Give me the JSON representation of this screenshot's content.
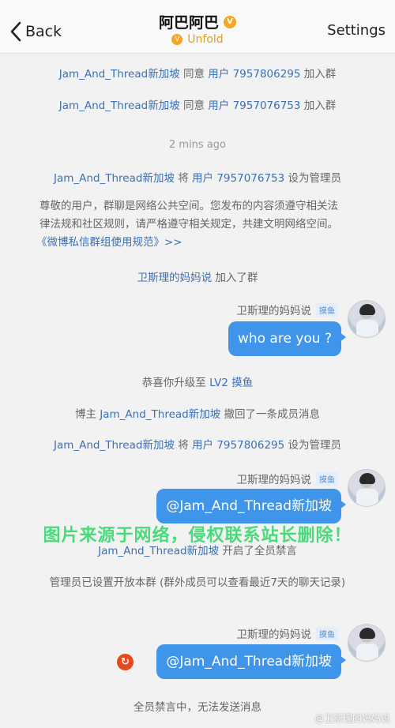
{
  "nav": {
    "back_label": "Back",
    "title": "阿巴阿巴",
    "unfold_label": "Unfold",
    "settings_label": "Settings"
  },
  "messages": {
    "m1": {
      "name": "Jam_And_Thread新加坡",
      "action": " 同意 ",
      "user": "用户 7957806295",
      "suffix": " 加入群"
    },
    "m2": {
      "name": "Jam_And_Thread新加坡",
      "action": " 同意 ",
      "user": "用户 7957076753",
      "suffix": " 加入群"
    },
    "time": "2 mins ago",
    "m3": {
      "name": "Jam_And_Thread新加坡",
      "action": " 将 ",
      "user": "用户 7957076753",
      "suffix": " 设为管理员"
    },
    "notice_line1": "尊敬的用户，群聊是网络公共空间。您发布的内容须遵守相关法",
    "notice_line2": "律法规和社区规则，请严格遵守相关规定，共建文明网络空间。",
    "notice_link": "《微博私信群组使用规范》>>",
    "m4": {
      "name": "卫斯理的妈妈说",
      "suffix": " 加入了群"
    },
    "chat1": {
      "sender": "卫斯理的妈妈说",
      "tag": "摸鱼",
      "text": "who are you ?"
    },
    "m5": {
      "prefix": "恭喜你升级至 ",
      "level": "LV2 摸鱼"
    },
    "m6": {
      "prefix": "博主 ",
      "name": "Jam_And_Thread新加坡",
      "suffix": " 撤回了一条成员消息"
    },
    "m7": {
      "name": "Jam_And_Thread新加坡",
      "action": " 将 ",
      "user": "用户 7957806295",
      "suffix": " 设为管理员"
    },
    "chat2": {
      "sender": "卫斯理的妈妈说",
      "tag": "摸鱼",
      "text": "@Jam_And_Thread新加坡"
    },
    "m8": {
      "name": "Jam_And_Thread新加坡",
      "suffix": " 开启了全员禁言"
    },
    "m9": "管理员已设置开放本群 (群外成员可以查看最近7天的聊天记录)",
    "chat3": {
      "sender": "卫斯理的妈妈说",
      "tag": "摸鱼",
      "text": "@Jam_And_Thread新加坡"
    },
    "m10": "全员禁言中，无法发送消息"
  },
  "overlay": {
    "watermark": "图片来源于网络，侵权联系站长删除！",
    "corner": "@卫斯理的妈妈说"
  },
  "colors": {
    "accent": "#3e95ea",
    "link": "#3a70b8",
    "vip": "#f5a623",
    "error": "#e8481f"
  }
}
